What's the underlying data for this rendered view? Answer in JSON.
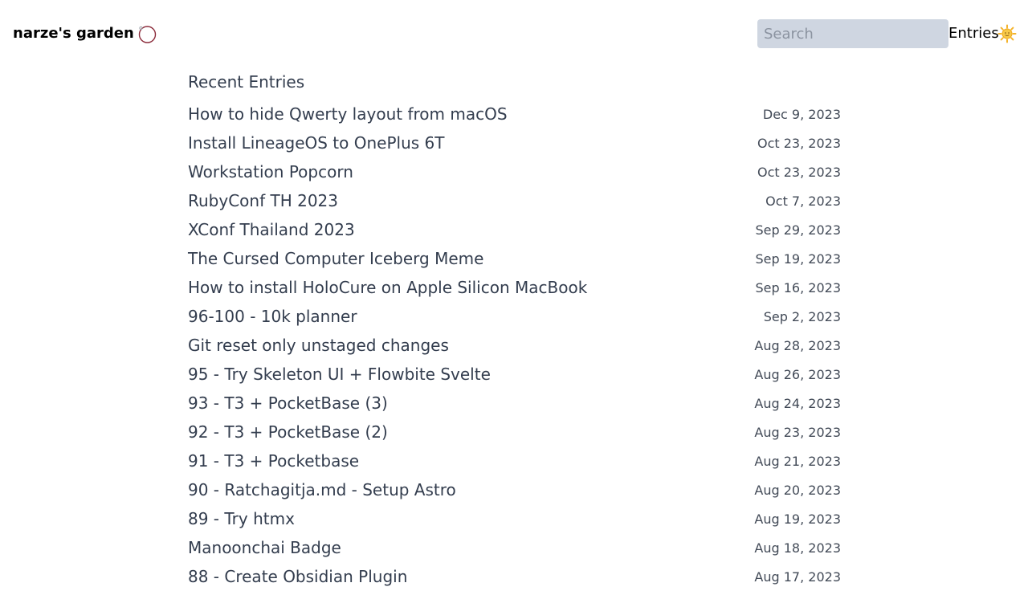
{
  "header": {
    "site_title": "narze's garden",
    "search_placeholder": "Search",
    "nav_entries_label": "Entries",
    "theme_icon": "sun-emoji-icon",
    "brand_icon": "ring-logo-icon"
  },
  "main": {
    "section_title": "Recent Entries",
    "entries": [
      {
        "title": "How to hide Qwerty layout from macOS",
        "date": "Dec 9, 2023"
      },
      {
        "title": "Install LineageOS to OnePlus 6T",
        "date": "Oct 23, 2023"
      },
      {
        "title": "Workstation Popcorn",
        "date": "Oct 23, 2023"
      },
      {
        "title": "RubyConf TH 2023",
        "date": "Oct 7, 2023"
      },
      {
        "title": "XConf Thailand 2023",
        "date": "Sep 29, 2023"
      },
      {
        "title": "The Cursed Computer Iceberg Meme",
        "date": "Sep 19, 2023"
      },
      {
        "title": "How to install HoloCure on Apple Silicon MacBook",
        "date": "Sep 16, 2023"
      },
      {
        "title": "96-100 - 10k planner",
        "date": "Sep 2, 2023"
      },
      {
        "title": "Git reset only unstaged changes",
        "date": "Aug 28, 2023"
      },
      {
        "title": "95 - Try Skeleton UI + Flowbite Svelte",
        "date": "Aug 26, 2023"
      },
      {
        "title": "93 - T3 + PocketBase (3)",
        "date": "Aug 24, 2023"
      },
      {
        "title": "92 - T3 + PocketBase (2)",
        "date": "Aug 23, 2023"
      },
      {
        "title": "91 - T3 + Pocketbase",
        "date": "Aug 21, 2023"
      },
      {
        "title": "90 - Ratchagitja.md - Setup Astro",
        "date": "Aug 20, 2023"
      },
      {
        "title": "89 - Try htmx",
        "date": "Aug 19, 2023"
      },
      {
        "title": "Manoonchai Badge",
        "date": "Aug 18, 2023"
      },
      {
        "title": "88 - Create Obsidian Plugin",
        "date": "Aug 17, 2023"
      }
    ]
  },
  "colors": {
    "search_bg": "#cfd6e1",
    "text": "#333d4e",
    "date_text": "#424a57",
    "logo_ring": "#8b2a3a"
  }
}
